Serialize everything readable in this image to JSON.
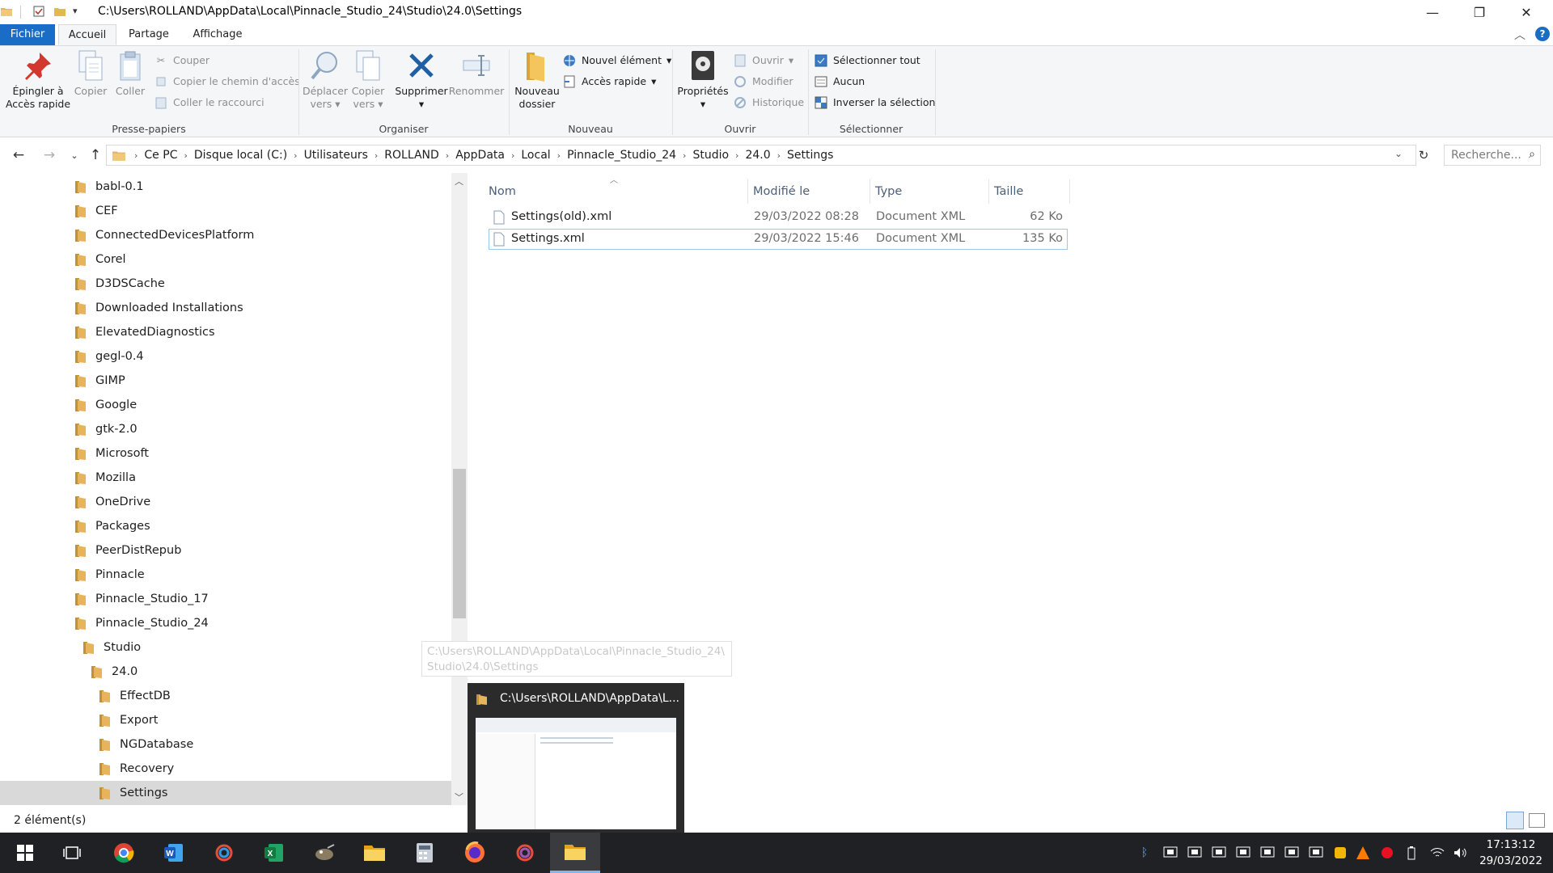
{
  "window": {
    "title_path": "C:\\Users\\ROLLAND\\AppData\\Local\\Pinnacle_Studio_24\\Studio\\24.0\\Settings",
    "controls": {
      "minimize": "—",
      "maximize": "❐",
      "close": "✕"
    }
  },
  "ribbon_tabs": [
    {
      "label": "Fichier"
    },
    {
      "label": "Accueil"
    },
    {
      "label": "Partage"
    },
    {
      "label": "Affichage"
    }
  ],
  "ribbon": {
    "presse_papiers": {
      "label": "Presse-papiers",
      "pin_line1": "Épingler à",
      "pin_line2": "Accès rapide",
      "copy": "Copier",
      "paste": "Coller",
      "cut": "Couper",
      "copy_path": "Copier le chemin d'accès",
      "paste_shortcut": "Coller le raccourci"
    },
    "organiser": {
      "label": "Organiser",
      "move_line1": "Déplacer",
      "move_line2": "vers",
      "copyto_line1": "Copier",
      "copyto_line2": "vers",
      "delete": "Supprimer",
      "rename": "Renommer"
    },
    "nouveau": {
      "label": "Nouveau",
      "new_folder_line1": "Nouveau",
      "new_folder_line2": "dossier",
      "new_item": "Nouvel élément",
      "easy_access": "Accès rapide"
    },
    "ouvrir": {
      "label": "Ouvrir",
      "properties": "Propriétés",
      "open": "Ouvrir",
      "edit": "Modifier",
      "history": "Historique"
    },
    "selectionner": {
      "label": "Sélectionner",
      "select_all": "Sélectionner tout",
      "select_none": "Aucun",
      "invert": "Inverser la sélection"
    }
  },
  "address": {
    "crumbs": [
      "Ce PC",
      "Disque local (C:)",
      "Utilisateurs",
      "ROLLAND",
      "AppData",
      "Local",
      "Pinnacle_Studio_24",
      "Studio",
      "24.0",
      "Settings"
    ],
    "search_placeholder": "Recherche..."
  },
  "tree": [
    {
      "label": "babl-0.1"
    },
    {
      "label": "CEF"
    },
    {
      "label": "ConnectedDevicesPlatform"
    },
    {
      "label": "Corel"
    },
    {
      "label": "D3DSCache"
    },
    {
      "label": "Downloaded Installations"
    },
    {
      "label": "ElevatedDiagnostics"
    },
    {
      "label": "gegl-0.4"
    },
    {
      "label": "GIMP"
    },
    {
      "label": "Google"
    },
    {
      "label": "gtk-2.0"
    },
    {
      "label": "Microsoft"
    },
    {
      "label": "Mozilla"
    },
    {
      "label": "OneDrive"
    },
    {
      "label": "Packages"
    },
    {
      "label": "PeerDistRepub"
    },
    {
      "label": "Pinnacle"
    },
    {
      "label": "Pinnacle_Studio_17"
    },
    {
      "label": "Pinnacle_Studio_24"
    },
    {
      "label": "Studio"
    },
    {
      "label": "24.0"
    },
    {
      "label": "EffectDB"
    },
    {
      "label": "Export"
    },
    {
      "label": "NGDatabase"
    },
    {
      "label": "Recovery"
    },
    {
      "label": "Settings"
    }
  ],
  "columns": {
    "name": "Nom",
    "modified": "Modifié le",
    "type": "Type",
    "size": "Taille"
  },
  "files": [
    {
      "name": "Settings(old).xml",
      "modified": "29/03/2022 08:28",
      "type": "Document XML",
      "size": "62 Ko"
    },
    {
      "name": "Settings.xml",
      "modified": "29/03/2022 15:46",
      "type": "Document XML",
      "size": "135 Ko"
    }
  ],
  "tooltip": {
    "line1": "C:\\Users\\ROLLAND\\AppData\\Local\\Pinnacle_Studio_24\\",
    "line2": "Studio\\24.0\\Settings"
  },
  "thumbnail": {
    "title": "C:\\Users\\ROLLAND\\AppData\\L..."
  },
  "status": {
    "count": "2 élément(s)"
  },
  "clock": {
    "time": "17:13:12",
    "date": "29/03/2022"
  },
  "colors": {
    "accent": "#1a6dc6",
    "folder": "#dcb46a",
    "taskbar": "#202124"
  }
}
